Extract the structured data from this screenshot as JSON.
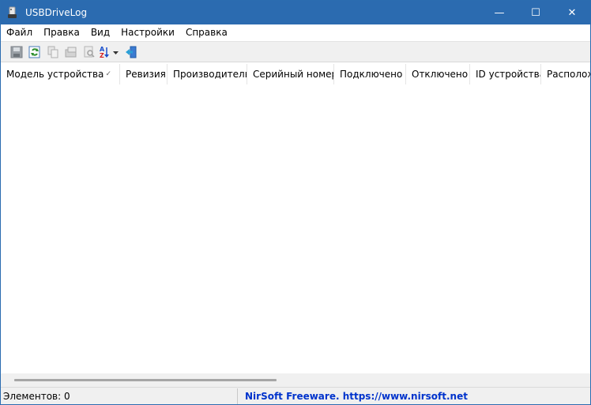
{
  "window": {
    "title": "USBDriveLog",
    "minimize_glyph": "—",
    "maximize_glyph": "☐",
    "close_glyph": "✕"
  },
  "menu": {
    "items": [
      "Файл",
      "Правка",
      "Вид",
      "Настройки",
      "Справка"
    ]
  },
  "toolbar": {
    "buttons": [
      "save-icon",
      "refresh-icon",
      "copy-icon",
      "properties-icon",
      "find-icon",
      "sort-az-icon",
      "exit-icon"
    ]
  },
  "table": {
    "columns": [
      "Модель устройства",
      "Ревизия",
      "Производитель",
      "Серийный номер",
      "Подключено",
      "Отключено",
      "ID устройства",
      "Располож"
    ],
    "sort_indicator": "✓",
    "rows": []
  },
  "status": {
    "count_label": "Элементов: 0",
    "link_text": "NirSoft Freeware. https://www.nirsoft.net"
  },
  "colors": {
    "titlebar": "#2b6bb0",
    "link": "#0033cc"
  }
}
